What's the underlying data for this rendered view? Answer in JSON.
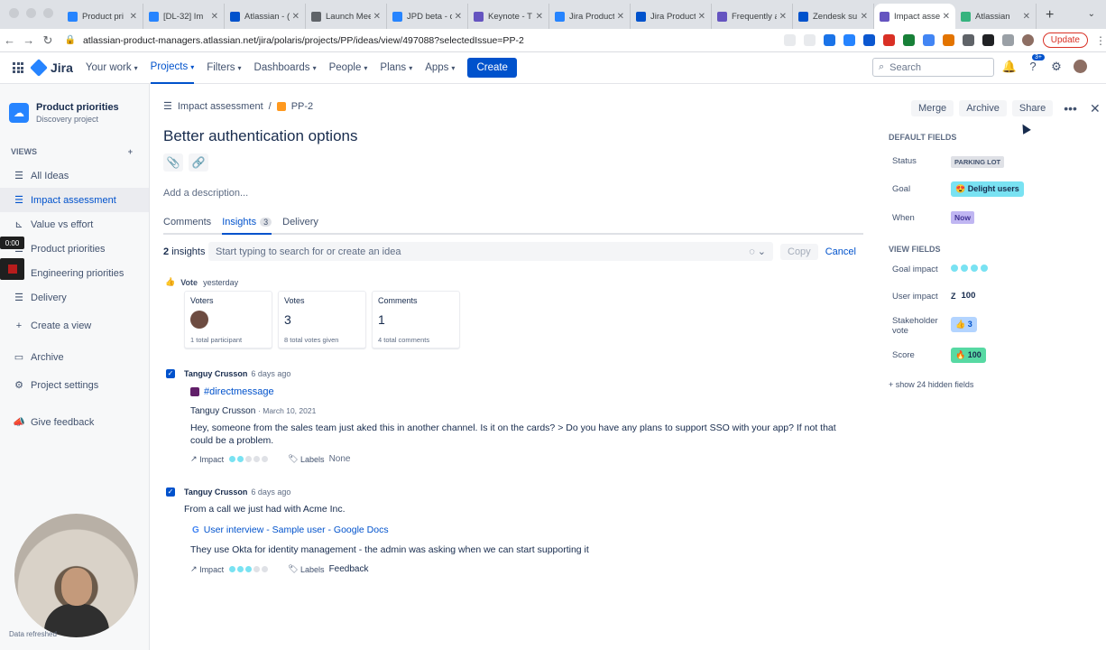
{
  "browser": {
    "tabs": [
      {
        "label": "Product pri",
        "color": "#2684ff"
      },
      {
        "label": "[DL-32] Im",
        "color": "#2684ff"
      },
      {
        "label": "Atlassian - (",
        "color": "#0052cc"
      },
      {
        "label": "Launch Mee",
        "color": "#5f6368"
      },
      {
        "label": "JPD beta - c",
        "color": "#2684ff"
      },
      {
        "label": "Keynote - T",
        "color": "#6554c0"
      },
      {
        "label": "Jira Product",
        "color": "#2684ff"
      },
      {
        "label": "Jira Product",
        "color": "#0052cc"
      },
      {
        "label": "Frequently a",
        "color": "#6554c0"
      },
      {
        "label": "Zendesk su",
        "color": "#0052cc"
      },
      {
        "label": "Impact asse",
        "color": "#6554c0"
      },
      {
        "label": "Atlassian",
        "color": "#36b37e"
      }
    ],
    "url": "atlassian-product-managers.atlassian.net/jira/polaris/projects/PP/ideas/view/497088?selectedIssue=PP-2",
    "update_label": "Update"
  },
  "topnav": {
    "product": "Jira",
    "items": [
      {
        "label": "Your work",
        "active": false
      },
      {
        "label": "Projects",
        "active": true
      },
      {
        "label": "Filters",
        "active": false
      },
      {
        "label": "Dashboards",
        "active": false
      },
      {
        "label": "People",
        "active": false
      },
      {
        "label": "Plans",
        "active": false
      },
      {
        "label": "Apps",
        "active": false
      }
    ],
    "create_label": "Create",
    "search_placeholder": "Search",
    "notif_badge": "3+"
  },
  "sidebar": {
    "project_name": "Product priorities",
    "project_type": "Discovery project",
    "views_heading": "VIEWS",
    "views": [
      {
        "label": "All Ideas",
        "icon": "list-icon",
        "active": false
      },
      {
        "label": "Impact assessment",
        "icon": "list-icon",
        "active": true
      },
      {
        "label": "Value vs effort",
        "icon": "matrix-icon",
        "active": false
      },
      {
        "label": "Product priorities",
        "icon": "list-icon",
        "active": false
      },
      {
        "label": "Engineering priorities",
        "icon": "list-icon",
        "active": false
      },
      {
        "label": "Delivery",
        "icon": "list-icon",
        "active": false
      }
    ],
    "create_view": "Create a view",
    "archive": "Archive",
    "settings": "Project settings",
    "feedback": "Give feedback",
    "timer": "0:00",
    "data_refreshed": "Data refreshed"
  },
  "issue": {
    "breadcrumb_view": "Impact assessment",
    "breadcrumb_key": "PP-2",
    "title": "Better authentication options",
    "description_placeholder": "Add a description...",
    "tabs": [
      {
        "label": "Comments",
        "active": false,
        "count": ""
      },
      {
        "label": "Insights",
        "active": true,
        "count": "3"
      },
      {
        "label": "Delivery",
        "active": false,
        "count": ""
      }
    ],
    "insights_count": "2",
    "insights_word": "insights",
    "search_placeholder": "Start typing to search for or create an idea",
    "copy_label": "Copy",
    "cancel_label": "Cancel",
    "vote": {
      "label": "Vote",
      "when": "yesterday",
      "boxes": [
        {
          "heading": "Voters",
          "value": "",
          "sub": "1 total participant"
        },
        {
          "heading": "Votes",
          "value": "3",
          "sub": "8 total votes given"
        },
        {
          "heading": "Comments",
          "value": "1",
          "sub": "4 total comments"
        }
      ]
    },
    "insights": [
      {
        "author": "Tanguy Crusson",
        "when": "6 days ago",
        "source": "#directmessage",
        "msg_author": "Tanguy Crusson",
        "msg_date": "· March 10, 2021",
        "text": "Hey, someone from the sales team just aked this in another channel. Is it on the cards? >  Do you have any plans to support SSO with your app? If not that could be a problem.",
        "impact_label": "Impact",
        "impact_level": 2,
        "labels_label": "Labels",
        "labels_value": "None"
      },
      {
        "author": "Tanguy Crusson",
        "when": "6 days ago",
        "intro": "From a call we just had with Acme Inc.",
        "source": "User interview - Sample user - Google Docs",
        "text": "They use Okta for identity management - the admin was asking when we can start supporting it",
        "impact_label": "Impact",
        "impact_level": 3,
        "labels_label": "Labels",
        "labels_value": "Feedback"
      }
    ]
  },
  "panel": {
    "buttons": [
      "Merge",
      "Archive",
      "Share"
    ],
    "default_heading": "DEFAULT FIELDS",
    "status_label": "Status",
    "status_value": "PARKING LOT",
    "goal_label": "Goal",
    "goal_value": "Delight users",
    "when_label": "When",
    "when_value": "Now",
    "view_heading": "VIEW FIELDS",
    "goal_impact_label": "Goal impact",
    "user_impact_label": "User impact",
    "user_impact_value": "100",
    "stakeholder_label_1": "Stakeholder",
    "stakeholder_label_2": "vote",
    "stakeholder_value": "3",
    "score_label": "Score",
    "score_value": "100",
    "show_hidden": "show 24 hidden fields"
  }
}
